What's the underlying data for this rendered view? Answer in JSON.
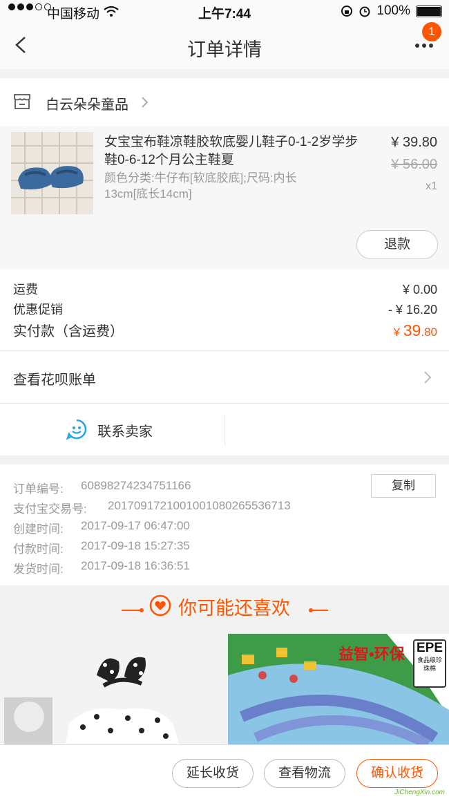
{
  "status_bar": {
    "carrier": "中国移动",
    "time": "上午7:44",
    "battery": "100%"
  },
  "nav": {
    "title": "订单详情",
    "badge": "1"
  },
  "shop": {
    "name": "白云朵朵童品"
  },
  "item": {
    "title": "女宝宝布鞋凉鞋胶软底婴儿鞋子0-1-2岁学步鞋0-6-12个月公主鞋夏",
    "sku": "颜色分类:牛仔布[软底胶底];尺码:内长13cm[底长14cm]",
    "price": "¥ 39.80",
    "original_price": "¥ 56.00",
    "quantity": "x1",
    "refund_label": "退款"
  },
  "fees": {
    "shipping_label": "运费",
    "shipping_value": "¥ 0.00",
    "promo_label": "优惠促销",
    "promo_value": "- ¥ 16.20",
    "total_label": "实付款（含运费）",
    "total_currency": "¥ ",
    "total_int": "39",
    "total_dec": ".80"
  },
  "huabei": {
    "label": "查看花呗账单"
  },
  "contact": {
    "label": "联系卖家"
  },
  "order_info": {
    "copy_label": "复制",
    "rows": [
      {
        "label": "订单编号:",
        "value": "60898274234751166"
      },
      {
        "label": "支付宝交易号:",
        "value": "2017091721001001080265536713"
      },
      {
        "label": "创建时间:",
        "value": "2017-09-17 06:47:00"
      },
      {
        "label": "付款时间:",
        "value": "2017-09-18 15:27:35"
      },
      {
        "label": "发货时间:",
        "value": "2017-09-18 16:36:51"
      }
    ]
  },
  "recommend": {
    "title": "你可能还喜欢",
    "prod2_text": "益智•环保",
    "prod2_tag": "EPE",
    "prod2_tag_sub": "食品级珍珠棉"
  },
  "bottom": {
    "extend_label": "延长收货",
    "logistics_label": "查看物流",
    "confirm_label": "确认收货"
  },
  "watermark": "JiChengXin.com",
  "colors": {
    "accent": "#ff5500",
    "contact_icon": "#29a3e6"
  }
}
